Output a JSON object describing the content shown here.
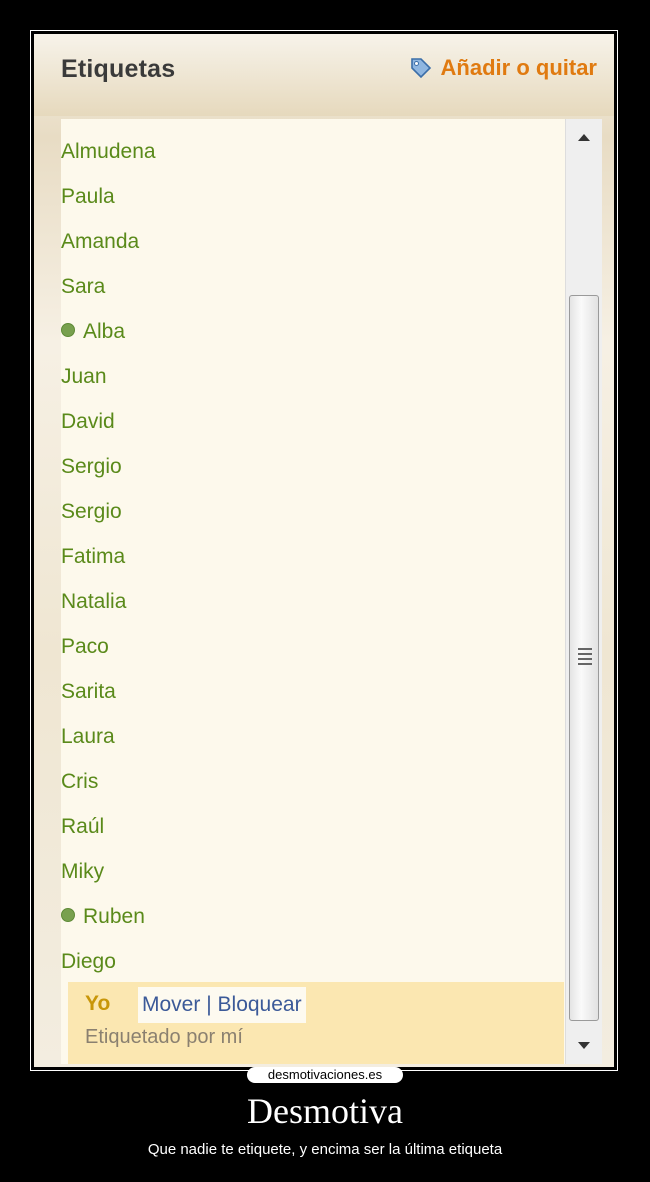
{
  "header": {
    "title": "Etiquetas",
    "add_remove_label": "Añadir o quitar"
  },
  "tags": [
    {
      "name": "Almudena",
      "online": false
    },
    {
      "name": "Paula",
      "online": false
    },
    {
      "name": "Amanda",
      "online": false
    },
    {
      "name": "Sara",
      "online": false
    },
    {
      "name": "Alba",
      "online": true
    },
    {
      "name": "Juan",
      "online": false
    },
    {
      "name": "David",
      "online": false
    },
    {
      "name": "Sergio",
      "online": false
    },
    {
      "name": "Sergio",
      "online": false
    },
    {
      "name": "Fatima",
      "online": false
    },
    {
      "name": "Natalia",
      "online": false
    },
    {
      "name": "Paco",
      "online": false
    },
    {
      "name": "Sarita",
      "online": false
    },
    {
      "name": "Laura",
      "online": false
    },
    {
      "name": "Cris",
      "online": false
    },
    {
      "name": "Raúl",
      "online": false
    },
    {
      "name": "Miky",
      "online": false
    },
    {
      "name": "Ruben",
      "online": true
    },
    {
      "name": "Diego",
      "online": false
    }
  ],
  "self_tag": {
    "name": "Yo",
    "move_label": "Mover",
    "separator": "|",
    "block_label": "Bloquear",
    "tagged_by": "Etiquetado por mí"
  },
  "icons": {
    "tag": "tag-icon",
    "online": "online-dot-icon",
    "scroll_up": "arrow-up-icon",
    "scroll_down": "arrow-down-icon",
    "grip": "grip-icon"
  },
  "colors": {
    "accent": "#e07a10",
    "name_link": "#5a8a1a",
    "action_link": "#3b5998",
    "self_highlight": "#fbe7b1"
  },
  "footer": {
    "site": "desmotivaciones.es",
    "caption": "Desmotiva",
    "subcaption": "Que nadie te etiquete, y encima ser la última etiqueta"
  }
}
